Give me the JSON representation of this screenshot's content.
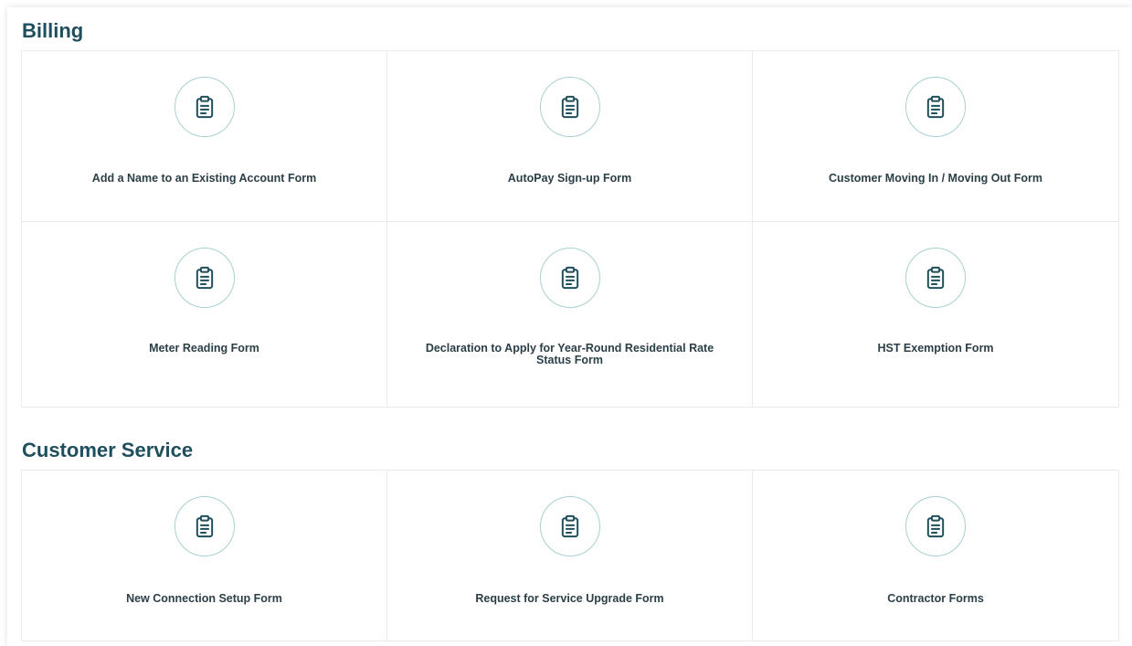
{
  "colors": {
    "heading": "#1f4f5c",
    "label": "#2b3f47",
    "icon_stroke": "#1f4f5c",
    "circle_border": "#a9d0d2",
    "divider": "#e8ecee"
  },
  "billing": {
    "title": "Billing",
    "cards": [
      {
        "label": "Add a Name to an Existing Account Form",
        "icon": "clipboard-icon"
      },
      {
        "label": "AutoPay Sign-up Form",
        "icon": "clipboard-icon"
      },
      {
        "label": "Customer Moving In / Moving Out Form",
        "icon": "clipboard-icon"
      },
      {
        "label": "Meter Reading Form",
        "icon": "clipboard-icon"
      },
      {
        "label": "Declaration to Apply for Year-Round Residential Rate Status Form",
        "icon": "clipboard-icon"
      },
      {
        "label": "HST Exemption Form",
        "icon": "clipboard-icon"
      }
    ]
  },
  "customer_service": {
    "title": "Customer Service",
    "cards": [
      {
        "label": "New Connection Setup Form",
        "icon": "clipboard-icon"
      },
      {
        "label": "Request for Service Upgrade Form",
        "icon": "clipboard-icon"
      },
      {
        "label": "Contractor Forms",
        "icon": "clipboard-icon"
      }
    ]
  }
}
